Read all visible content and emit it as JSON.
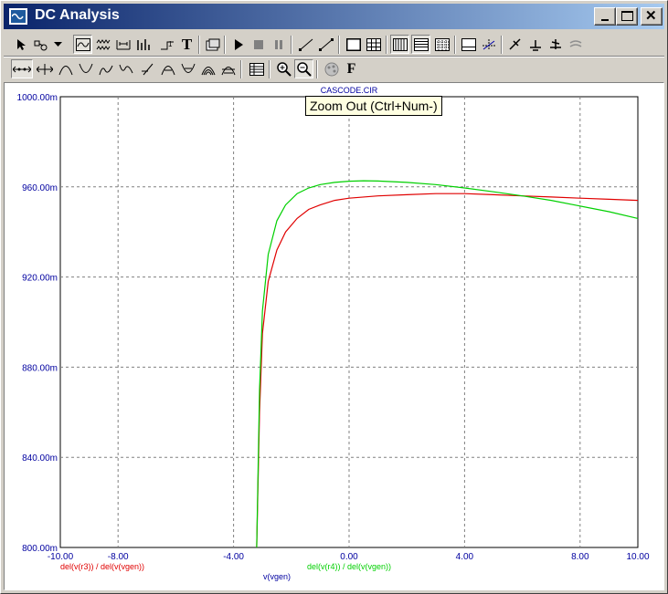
{
  "window": {
    "title": "DC Analysis",
    "controls": {
      "minimize": "_",
      "maximize": "□",
      "close": "✕"
    }
  },
  "toolbar_row1": [
    "select-arrow-icon",
    "component-icon",
    "dropdown-arrow-icon",
    "scope-icon",
    "waveform-icon",
    "resize-icon",
    "bar-chart-icon",
    "node-icon",
    "text-tool-icon",
    "export-icon",
    "run-icon",
    "stop-icon",
    "pause-icon",
    "line-icon",
    "diagonal-line-icon",
    "frame-icon",
    "grid-icon",
    "vertical-bars-icon",
    "horizontal-bars-icon",
    "dotted-grid-icon",
    "baseline-icon",
    "crosshair-icon",
    "probe-icon",
    "probe-down-icon",
    "probe-both-icon",
    "probe-off-icon"
  ],
  "toolbar_row2": [
    "cursor-left-right-icon",
    "cursor-plus-icon",
    "peak-icon",
    "valley-icon",
    "high-icon",
    "low-icon",
    "slope-icon",
    "rising-icon",
    "falling-icon",
    "max-icon",
    "min-icon",
    "table-icon",
    "zoom-in-icon",
    "zoom-out-icon",
    "color-palette-icon",
    "font-icon"
  ],
  "tooltip": "Zoom Out (Ctrl+Num-)",
  "colors": {
    "axis_text": "#0000a0",
    "series_red": "#e00000",
    "series_green": "#00d000",
    "grid": "#808080"
  },
  "chart_data": {
    "type": "line",
    "title": "CASCODE.CIR",
    "xlabel": "v(vgen)",
    "ylabel": "",
    "xlim": [
      -10,
      10
    ],
    "ylim": [
      0.8,
      1.0
    ],
    "x_ticks": [
      "-10.00",
      "-8.00",
      "-4.00",
      "0.00",
      "4.00",
      "8.00",
      "10.00"
    ],
    "x_tick_values": [
      -10,
      -8,
      -4,
      0,
      4,
      8,
      10
    ],
    "y_ticks": [
      "800.00m",
      "840.00m",
      "880.00m",
      "920.00m",
      "960.00m",
      "1000.00m"
    ],
    "y_tick_values": [
      0.8,
      0.84,
      0.88,
      0.92,
      0.96,
      1.0
    ],
    "grid": true,
    "series": [
      {
        "name": "del(v(r3)) / del(v(vgen))",
        "color": "#e00000",
        "x": [
          -3.2,
          -3.1,
          -3.0,
          -2.8,
          -2.5,
          -2.2,
          -1.8,
          -1.4,
          -1.0,
          -0.5,
          0.0,
          1.0,
          2.0,
          3.0,
          4.0,
          5.0,
          6.0,
          7.0,
          8.0,
          9.0,
          10.0
        ],
        "y": [
          0.8,
          0.86,
          0.895,
          0.918,
          0.932,
          0.94,
          0.946,
          0.95,
          0.952,
          0.954,
          0.955,
          0.956,
          0.9565,
          0.957,
          0.957,
          0.9565,
          0.956,
          0.9555,
          0.955,
          0.9545,
          0.954
        ]
      },
      {
        "name": "del(v(r4)) / del(v(vgen))",
        "color": "#00d000",
        "x": [
          -3.2,
          -3.1,
          -3.0,
          -2.8,
          -2.5,
          -2.2,
          -1.8,
          -1.4,
          -1.0,
          -0.5,
          0.0,
          0.5,
          1.0,
          2.0,
          3.0,
          4.0,
          5.0,
          6.0,
          7.0,
          8.0,
          9.0,
          10.0
        ],
        "y": [
          0.8,
          0.87,
          0.905,
          0.93,
          0.945,
          0.952,
          0.957,
          0.9595,
          0.961,
          0.962,
          0.9625,
          0.9627,
          0.9626,
          0.962,
          0.961,
          0.9595,
          0.9578,
          0.956,
          0.954,
          0.9515,
          0.949,
          0.946
        ]
      }
    ]
  }
}
